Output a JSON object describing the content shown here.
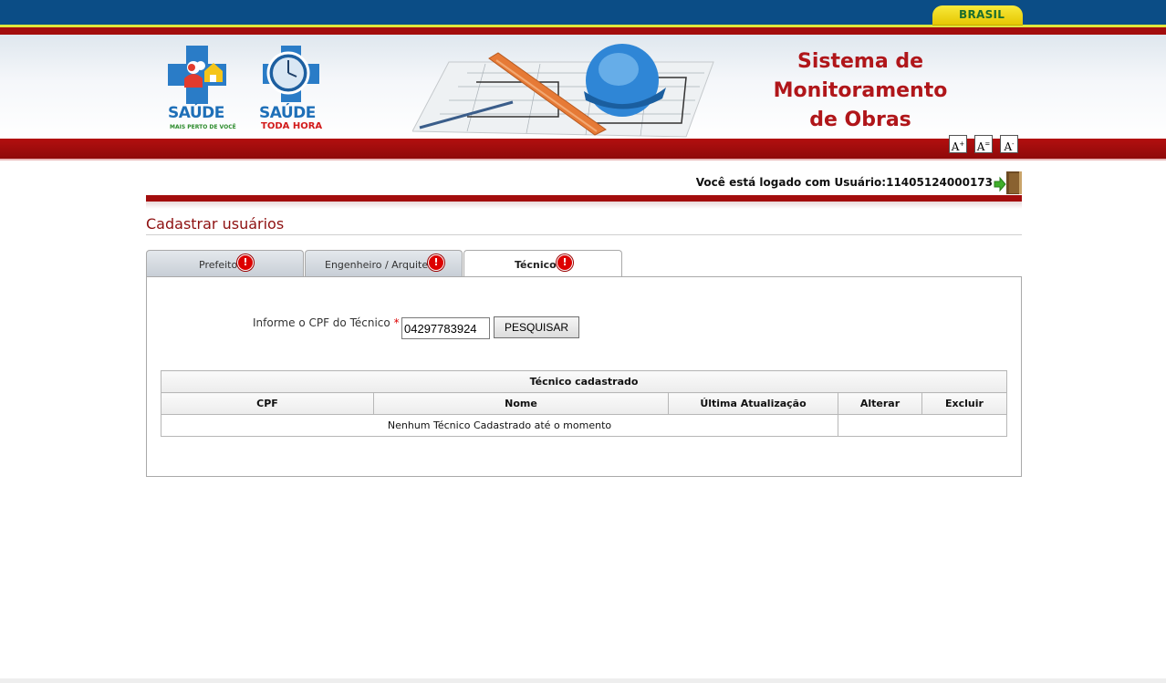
{
  "gov_bar": {
    "brand": "BRASIL"
  },
  "logos": [
    {
      "name": "SAÚDE",
      "subtitle": "MAIS PERTO DE VOCÊ"
    },
    {
      "name": "SAÚDE",
      "subtitle": "TODA HORA"
    }
  ],
  "site_title": [
    "Sistema de",
    "Monitoramento",
    "de Obras"
  ],
  "font_controls": [
    "A+",
    "A=",
    "A-"
  ],
  "login": {
    "text": "Você está logado com Usuário:11405124000173"
  },
  "page_title": "Cadastrar usuários",
  "tabs": [
    {
      "label": "Prefeito",
      "warning": "!"
    },
    {
      "label": "Engenheiro / Arquiteto",
      "warning": "!"
    },
    {
      "label": "Técnico",
      "warning": "!",
      "active": true
    }
  ],
  "form": {
    "cpf_label": "Informe o CPF do Técnico",
    "required_mark": "*",
    "cpf_value": "04297783924",
    "search_button": "PESQUISAR"
  },
  "table": {
    "caption": "Técnico cadastrado",
    "columns": [
      "CPF",
      "Nome",
      "Última Atualização",
      "Alterar",
      "Excluir"
    ],
    "empty_message": "Nenhum Técnico Cadastrado até o momento"
  },
  "colors": {
    "gov_blue": "#0b4d86",
    "brand_red": "#a30d0d",
    "title_red": "#b0161a"
  }
}
